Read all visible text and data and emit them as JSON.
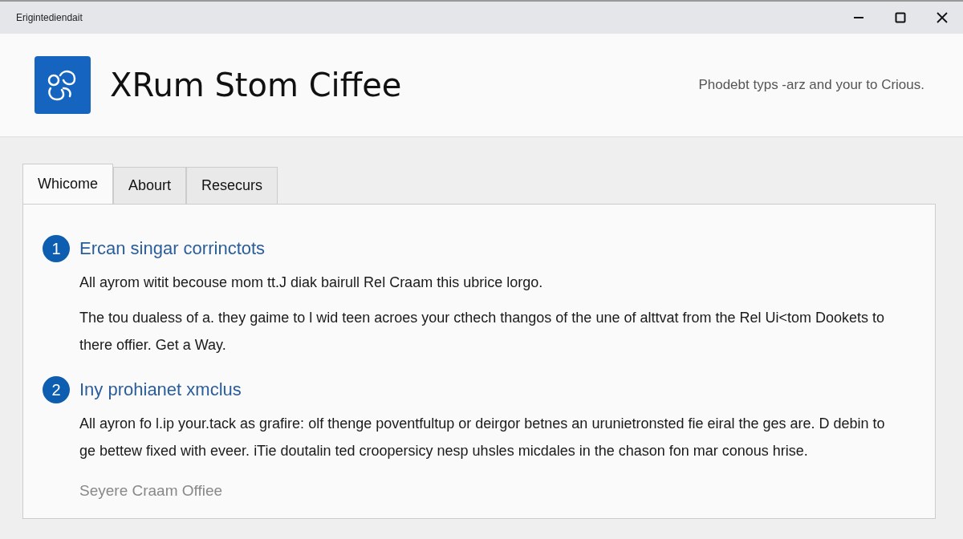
{
  "window": {
    "title": "Erigintediendait"
  },
  "header": {
    "app_name": "XRum Stom Ciffee",
    "tagline": "Phodebt typs -arz and your to Crious."
  },
  "tabs": [
    {
      "label": "Whicome",
      "selected": true
    },
    {
      "label": "Abourt",
      "selected": false
    },
    {
      "label": "Resecurs",
      "selected": false
    }
  ],
  "sections": [
    {
      "number": "1",
      "heading": "Ercan singar corrinctots",
      "paragraphs": [
        "All ayrom witit becouse mom tt.J diak bairull Rel Craam this ubrice lorgo.",
        "The tou dualess of a. they gaime to l wid teen acroes your cthech thangos of the une of alttvat from the Rel Ui<tom Dookets to there offier. Get a Way."
      ]
    },
    {
      "number": "2",
      "heading": "Iny prohianet xmclus",
      "paragraphs": [
        "All ayron fo l.ip your.tack as grafire: olf thenge poventfultup or deirgor betnes an urunietronsted fie eiral the ges are. D debin to ge bettew fixed with eveer. iTie doutalin ted croopersicy nesp uhsles micdales in the chason fon mar conous hrise."
      ]
    }
  ],
  "footer_note": "Seyere Craam Offiee"
}
